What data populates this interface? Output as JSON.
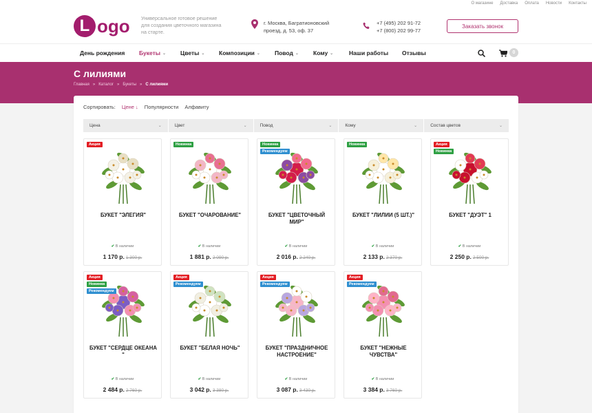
{
  "toplinks": [
    "О магазине",
    "Доставка",
    "Оплата",
    "Новости",
    "Контакты"
  ],
  "logo": {
    "letter": "L",
    "text": "ogo"
  },
  "tagline": "Универсальное готовое решение для создания цветочного магазина на старте.",
  "address": "г. Москва, Багратионовский проезд, д. 53, оф. 37",
  "phones": [
    "+7 (495) 202 91-72",
    "+7 (800) 202 99-77"
  ],
  "callback_label": "Заказать звонок",
  "nav": [
    {
      "label": "День рождения",
      "dropdown": false
    },
    {
      "label": "Букеты",
      "dropdown": true
    },
    {
      "label": "Цветы",
      "dropdown": true
    },
    {
      "label": "Композиции",
      "dropdown": true
    },
    {
      "label": "Повод",
      "dropdown": true
    },
    {
      "label": "Кому",
      "dropdown": true
    },
    {
      "label": "Наши работы",
      "dropdown": false
    },
    {
      "label": "Отзывы",
      "dropdown": false
    }
  ],
  "cart_count": "0",
  "page_title": "С лилиями",
  "breadcrumb": [
    "Главная",
    "Каталог",
    "Букеты",
    "С лилиями"
  ],
  "sort": {
    "label": "Сортировать:",
    "options": [
      "Цене",
      "Популярности",
      "Алфавиту"
    ]
  },
  "filters": [
    "Цена",
    "Цвет",
    "Повод",
    "Кому",
    "Состав цветов"
  ],
  "stock_label": "В наличии",
  "badge_labels": {
    "sale": "Акция",
    "new": "Новинка",
    "rec": "Рекомендуем"
  },
  "products": [
    {
      "name": "Букет \"Элегия\"",
      "price": "1 170 р.",
      "old_price": "1 300 р.",
      "badges": [
        "sale"
      ]
    },
    {
      "name": "Букет \"Очарование\"",
      "price": "1 881 р.",
      "old_price": "2 090 р.",
      "badges": [
        "new"
      ]
    },
    {
      "name": "Букет \"Цветочный мир\"",
      "price": "2 016 р.",
      "old_price": "2 240 р.",
      "badges": [
        "new",
        "rec"
      ]
    },
    {
      "name": "Букет \"Лилии (5 шт.)\"",
      "price": "2 133 р.",
      "old_price": "2 370 р.",
      "badges": [
        "new"
      ]
    },
    {
      "name": "Букет \"Дуэт\" 1",
      "price": "2 250 р.",
      "old_price": "2 500 р.",
      "badges": [
        "sale",
        "new"
      ]
    },
    {
      "name": "Букет \"Сердце океана \"",
      "price": "2 484 р.",
      "old_price": "2 760 р.",
      "badges": [
        "sale",
        "new",
        "rec"
      ]
    },
    {
      "name": "Букет \"Белая ночь\"",
      "price": "3 042 р.",
      "old_price": "3 380 р.",
      "badges": [
        "sale",
        "rec"
      ]
    },
    {
      "name": "Букет \"Праздничное настроение\"",
      "price": "3 087 р.",
      "old_price": "3 430 р.",
      "badges": [
        "sale",
        "rec"
      ]
    },
    {
      "name": "Букет \"Нежные чувства\"",
      "price": "3 384 р.",
      "old_price": "3 760 р.",
      "badges": [
        "sale",
        "rec"
      ]
    }
  ],
  "colors": {
    "brand": "#a8306f",
    "sale": "#e31e24",
    "new": "#2ea043",
    "rec": "#2f8fd0"
  }
}
